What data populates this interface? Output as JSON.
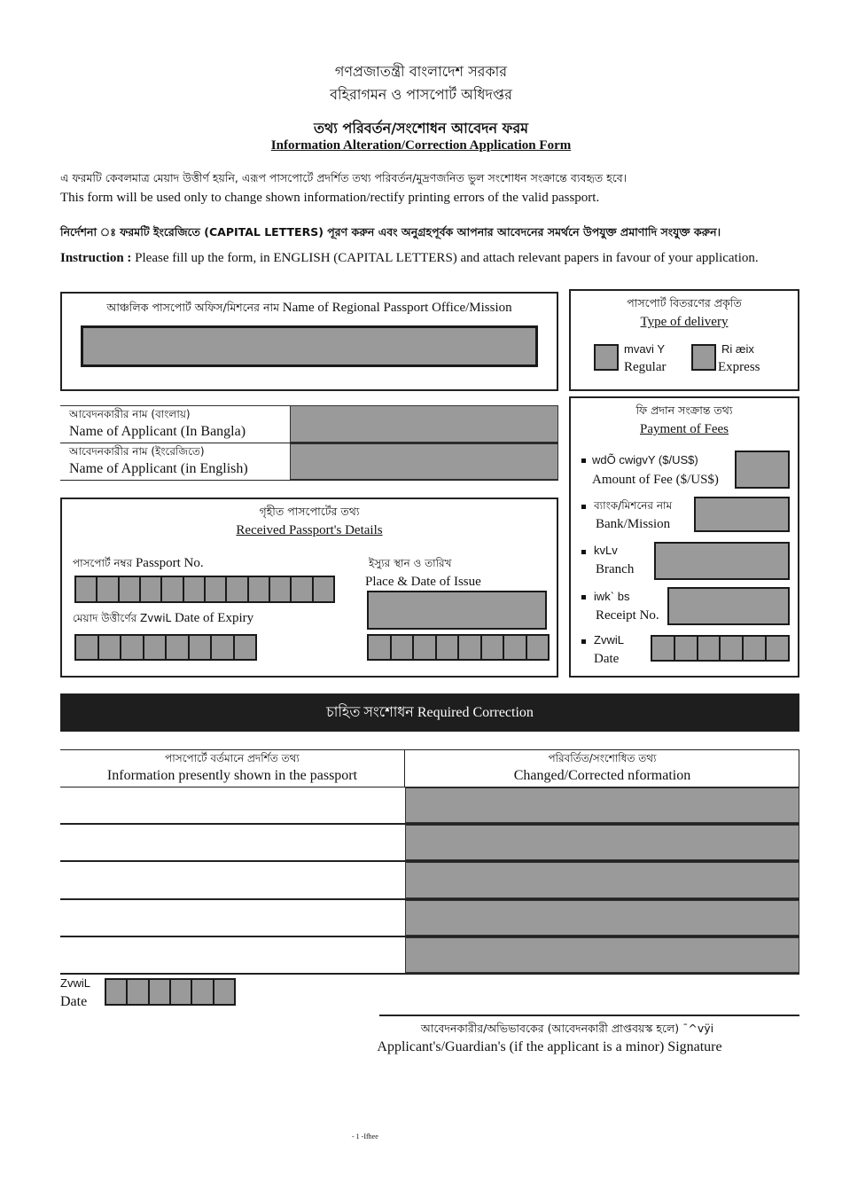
{
  "header": {
    "govt_bn": "গণপ্রজাতন্ত্রী বাংলাদেশ সরকার",
    "dept_bn": "বহিরাগমন ও পাসপোর্ট অধিদপ্তর",
    "title_bn": "তথ্য পরিবর্তন/সংশোধন আবেদন ফরম",
    "title_en": "Information Alteration/Correction Application Form"
  },
  "intro": {
    "purpose_bn": "এ ফরমটি কেবলমাত্র মেয়াদ উত্তীর্ণ হয়নি, এরূপ পাসপোর্টে প্রদর্শিত তথ্য পরিবর্তন/মুদ্রণজনিত ভুল সংশোধন সংক্রান্তে ব্যবহৃত হবে।",
    "purpose_en": "This form will be used only to change shown information/rectify printing errors of the valid passport.",
    "instruction_bn": "নির্দেশনা ঃ ফরমটি ইংরেজিতে (CAPITAL LETTERS) পূরণ করুন এবং অনুগ্রহপূর্বক আপনার আবেদনের সমর্থনে উপযুক্ত প্রমাণাদি সংযুক্ত করুন।",
    "instruction_label": "Instruction :",
    "instruction_en": "Please fill up the form, in ENGLISH (CAPITAL LETTERS) and attach relevant papers in favour of your application."
  },
  "regional_office": {
    "label_bn": "আঞ্চলিক পাসপোর্ট অফিস/মিশনের নাম",
    "label_en": "Name of Regional Passport Office/Mission",
    "value": ""
  },
  "delivery": {
    "title_bn": "পাসপোর্ট বিতরণের প্রকৃতি",
    "title_en": "Type of delivery",
    "options": [
      {
        "label_bn": "mvavi Y",
        "label_en": "Regular",
        "checked": false
      },
      {
        "label_bn": "Ri æix",
        "label_en": "Express",
        "checked": false
      }
    ]
  },
  "applicant": {
    "bangla_label_bn": "আবেদনকারীর নাম (বাংলায়)",
    "bangla_label_en": "Name of Applicant (In Bangla)",
    "bangla_value": "",
    "english_label_bn": "আবেদনকারীর নাম (ইংরেজিতে)",
    "english_label_en": "Name of Applicant (in English)",
    "english_value": ""
  },
  "received_passport": {
    "title_bn": "গৃহীত পাসপোর্টের তথ্য",
    "title_en": "Received Passport's Details",
    "passport_no_label_bn": "পাসপোর্ট নম্বর",
    "passport_no_label_en": "Passport No.",
    "passport_no_cells": 12,
    "expiry_label_bn": "মেয়াদ উত্তীর্ণের ZvwiL",
    "expiry_label_en": "Date of Expiry",
    "expiry_cells": 8,
    "issue_label_bn": "ইস্যুর স্থান ও তারিখ",
    "issue_label_en": "Place & Date of Issue",
    "issue_place_value": "",
    "issue_date_cells": 8
  },
  "payment": {
    "title_bn": "ফি প্রদান সংক্রান্ত তথ্য",
    "title_en": "Payment of Fees",
    "amount_label_bn": "wdÕ cwigvY ($/US$)",
    "amount_label_en": "Amount of Fee ($/US$)",
    "amount_value": "",
    "bank_label_bn": "ব্যাংক/মিশনের নাম",
    "bank_label_en": "Bank/Mission",
    "bank_value": "",
    "branch_label_bn": "kvLv",
    "branch_label_en": "Branch",
    "branch_value": "",
    "receipt_label_bn": "iwk` bs",
    "receipt_label_en": "Receipt No.",
    "receipt_value": "",
    "date_label_bn": "ZvwiL",
    "date_label_en": "Date",
    "date_cells": 6
  },
  "correction": {
    "banner": "চাহিত সংশোধন Required Correction",
    "col1_bn": "পাসপোর্টে বর্তমানে প্রদর্শিত তথ্য",
    "col1_en": "Information presently shown in the passport",
    "col2_bn": "পরিবর্তিত/সংশোধিত তথ্য",
    "col2_en": "Changed/Corrected nformation",
    "rows": [
      {
        "current": "",
        "corrected": ""
      },
      {
        "current": "",
        "corrected": ""
      },
      {
        "current": "",
        "corrected": ""
      },
      {
        "current": "",
        "corrected": ""
      },
      {
        "current": "",
        "corrected": ""
      }
    ]
  },
  "footer": {
    "date_label_bn": "ZvwiL",
    "date_label_en": "Date",
    "date_cells": 6,
    "signature_bn": "আবেদনকারীর/অভিভাবকের (আবেদনকারী প্রাপ্তবয়স্ক হলে) ¯^vÿi",
    "signature_en": "Applicant's/Guardian's (if the applicant is a minor) Signature",
    "page_number": "- 1 -Ifhee"
  }
}
